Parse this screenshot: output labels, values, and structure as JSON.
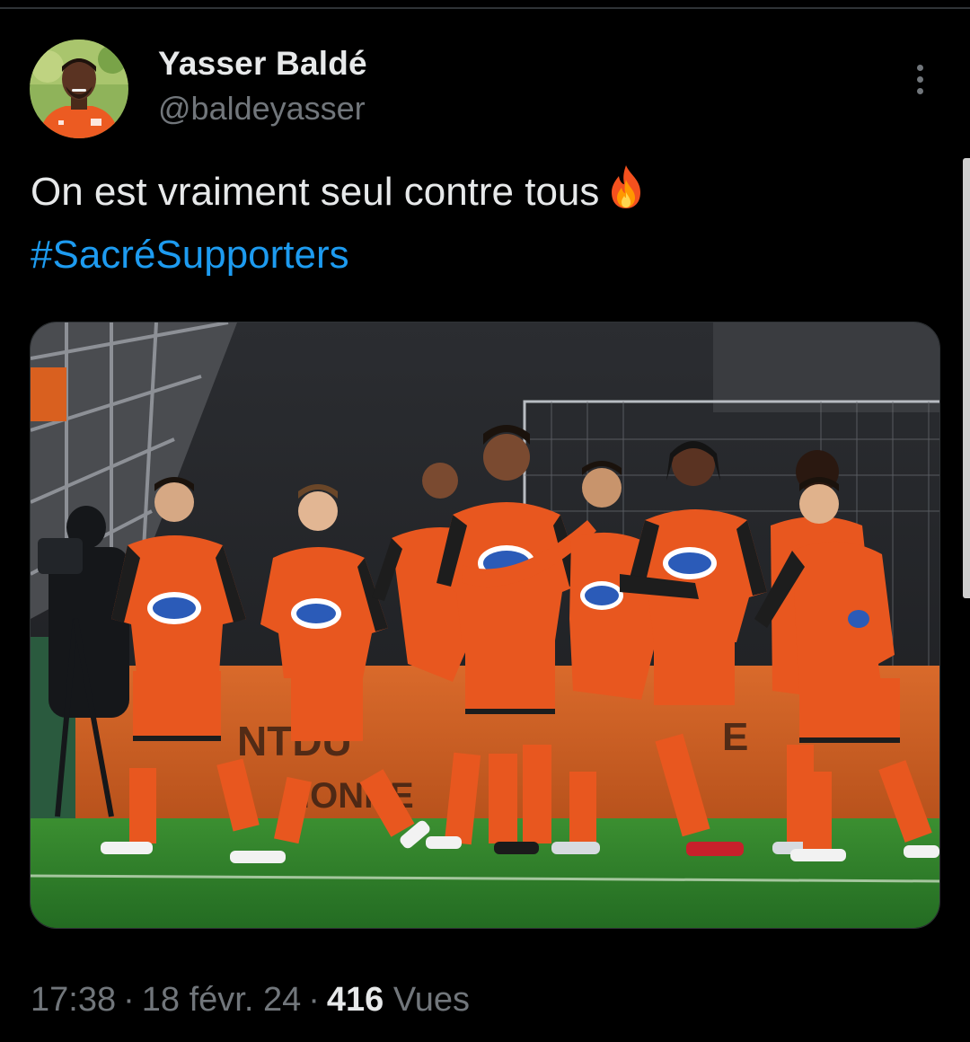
{
  "author": {
    "display_name": "Yasser Baldé",
    "handle": "@baldeyasser"
  },
  "tweet": {
    "text": "On est vraiment seul contre tous",
    "emoji": "fire-emoji",
    "hashtag": "#SacréSupporters"
  },
  "meta": {
    "time": "17:38",
    "separator": "·",
    "date": "18 févr. 24",
    "views_count": "416",
    "views_label": "Vues"
  },
  "icons": {
    "more": "more-vertical-icon"
  },
  "colors": {
    "background": "#000000",
    "text": "#e7e9ea",
    "secondary_text": "#71767b",
    "link": "#1d9bf0",
    "jersey_orange": "#e8571f",
    "pitch_green": "#2f7d2a"
  }
}
